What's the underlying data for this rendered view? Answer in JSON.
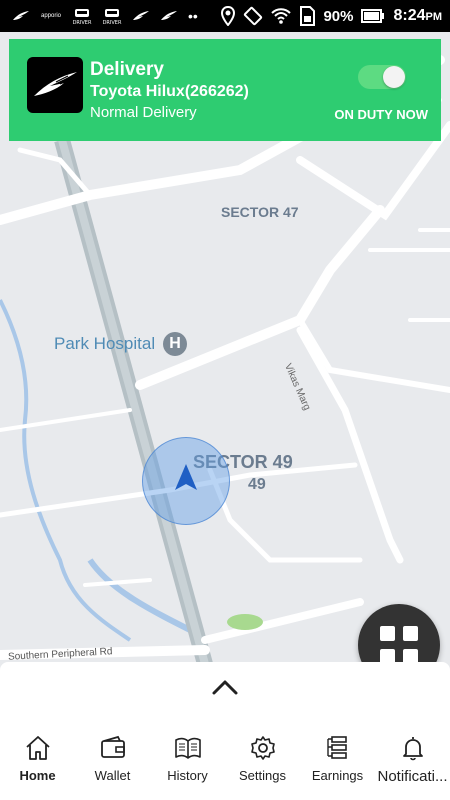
{
  "status_bar": {
    "battery_percent": "90%",
    "time": "8:24",
    "ampm": "PM",
    "mini_label": "apporio",
    "driver_label": "DRIVER",
    "dots": "••"
  },
  "card": {
    "title": "Delivery",
    "vehicle": "Toyota Hilux(266262)",
    "delivery_type": "Normal Delivery",
    "duty_status": "ON DUTY NOW",
    "toggle_on": true,
    "color": "#2ecc71"
  },
  "map": {
    "labels": {
      "sector47": "SECTOR 47",
      "sector49": "SECTOR 49",
      "sector49_num": "49",
      "park_hospital": "Park Hospital",
      "hospital_icon": "H",
      "vikas_marg": "Vikas Marg",
      "southern_rd": "Southern Peripheral Rd"
    }
  },
  "nav": {
    "items": [
      {
        "label": "Home",
        "icon": "home-icon"
      },
      {
        "label": "Wallet",
        "icon": "wallet-icon"
      },
      {
        "label": "History",
        "icon": "book-icon"
      },
      {
        "label": "Settings",
        "icon": "gear-icon"
      },
      {
        "label": "Earnings",
        "icon": "earnings-icon"
      },
      {
        "label": "Notificati...",
        "icon": "bell-icon"
      }
    ]
  }
}
